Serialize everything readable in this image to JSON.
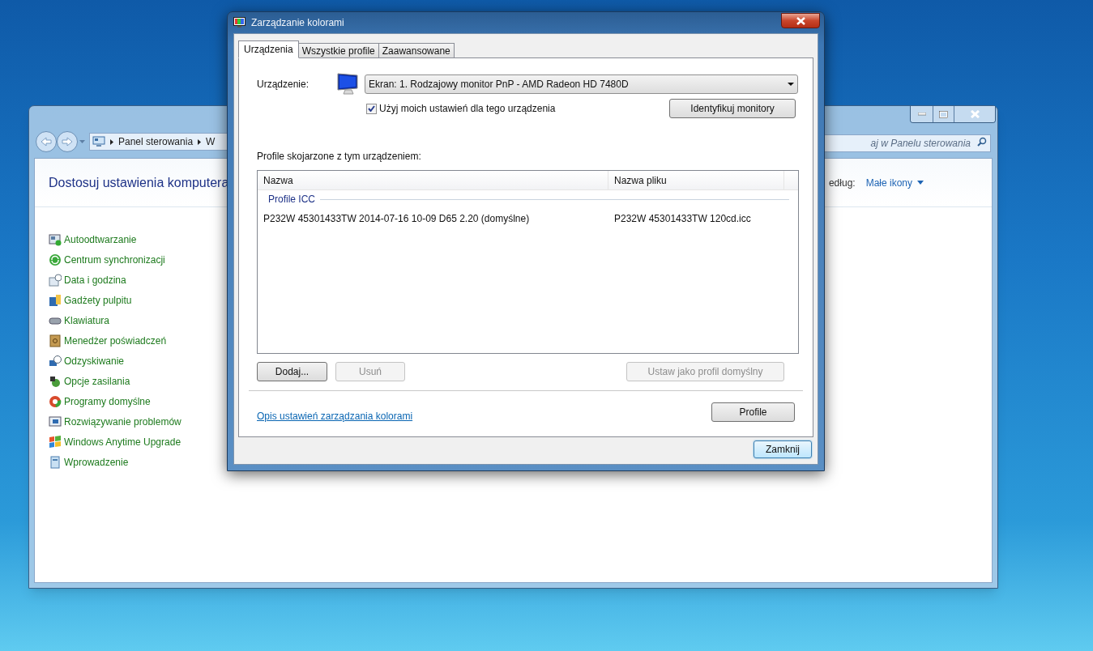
{
  "control_panel": {
    "breadcrumb": [
      "Panel sterowania",
      "W"
    ],
    "search": {
      "placeholder": "aj w Panelu sterowania"
    },
    "heading": "Dostosuj ustawienia komputera",
    "view_by_label": "edług:",
    "view_by_value": "Małe ikony",
    "items": [
      "Autoodtwarzanie",
      "Centrum synchronizacji",
      "Data i godzina",
      "Gadżety pulpitu",
      "Klawiatura",
      "Menedżer poświadczeń",
      "Odzyskiwanie",
      "Opcje zasilania",
      "Programy domyślne",
      "Rozwiązywanie problemów",
      "Windows Anytime Upgrade",
      "Wprowadzenie"
    ]
  },
  "dialog": {
    "title": "Zarządzanie kolorami",
    "tabs": [
      {
        "label": "Urządzenia",
        "selected": true
      },
      {
        "label": "Wszystkie profile",
        "selected": false
      },
      {
        "label": "Zaawansowane",
        "selected": false
      }
    ],
    "device_label": "Urządzenie:",
    "device_value": "Ekran: 1. Rodzajowy monitor PnP - AMD Radeon HD 7480D",
    "use_settings": {
      "label": "Użyj moich ustawień dla tego urządzenia",
      "checked": true
    },
    "identify_button": "Identyfikuj monitory",
    "profiles_label": "Profile skojarzone z tym urządzeniem:",
    "columns": [
      "Nazwa",
      "Nazwa pliku"
    ],
    "groups": [
      {
        "name": "Profile ICC",
        "rows": [
          {
            "name": "P232W 45301433TW 2014-07-16 10-09 D65 2.20 (domyślne)",
            "file": "P232W 45301433TW 120cd.icc"
          }
        ]
      }
    ],
    "buttons": [
      {
        "label": "Dodaj...",
        "disabled": false
      },
      {
        "label": "Usuń",
        "disabled": true
      },
      {
        "label": "Ustaw jako profil domyślny",
        "disabled": true
      }
    ],
    "link": "Opis ustawień zarządzania kolorami",
    "profile_button": "Profile",
    "close_button": "Zamknij"
  }
}
